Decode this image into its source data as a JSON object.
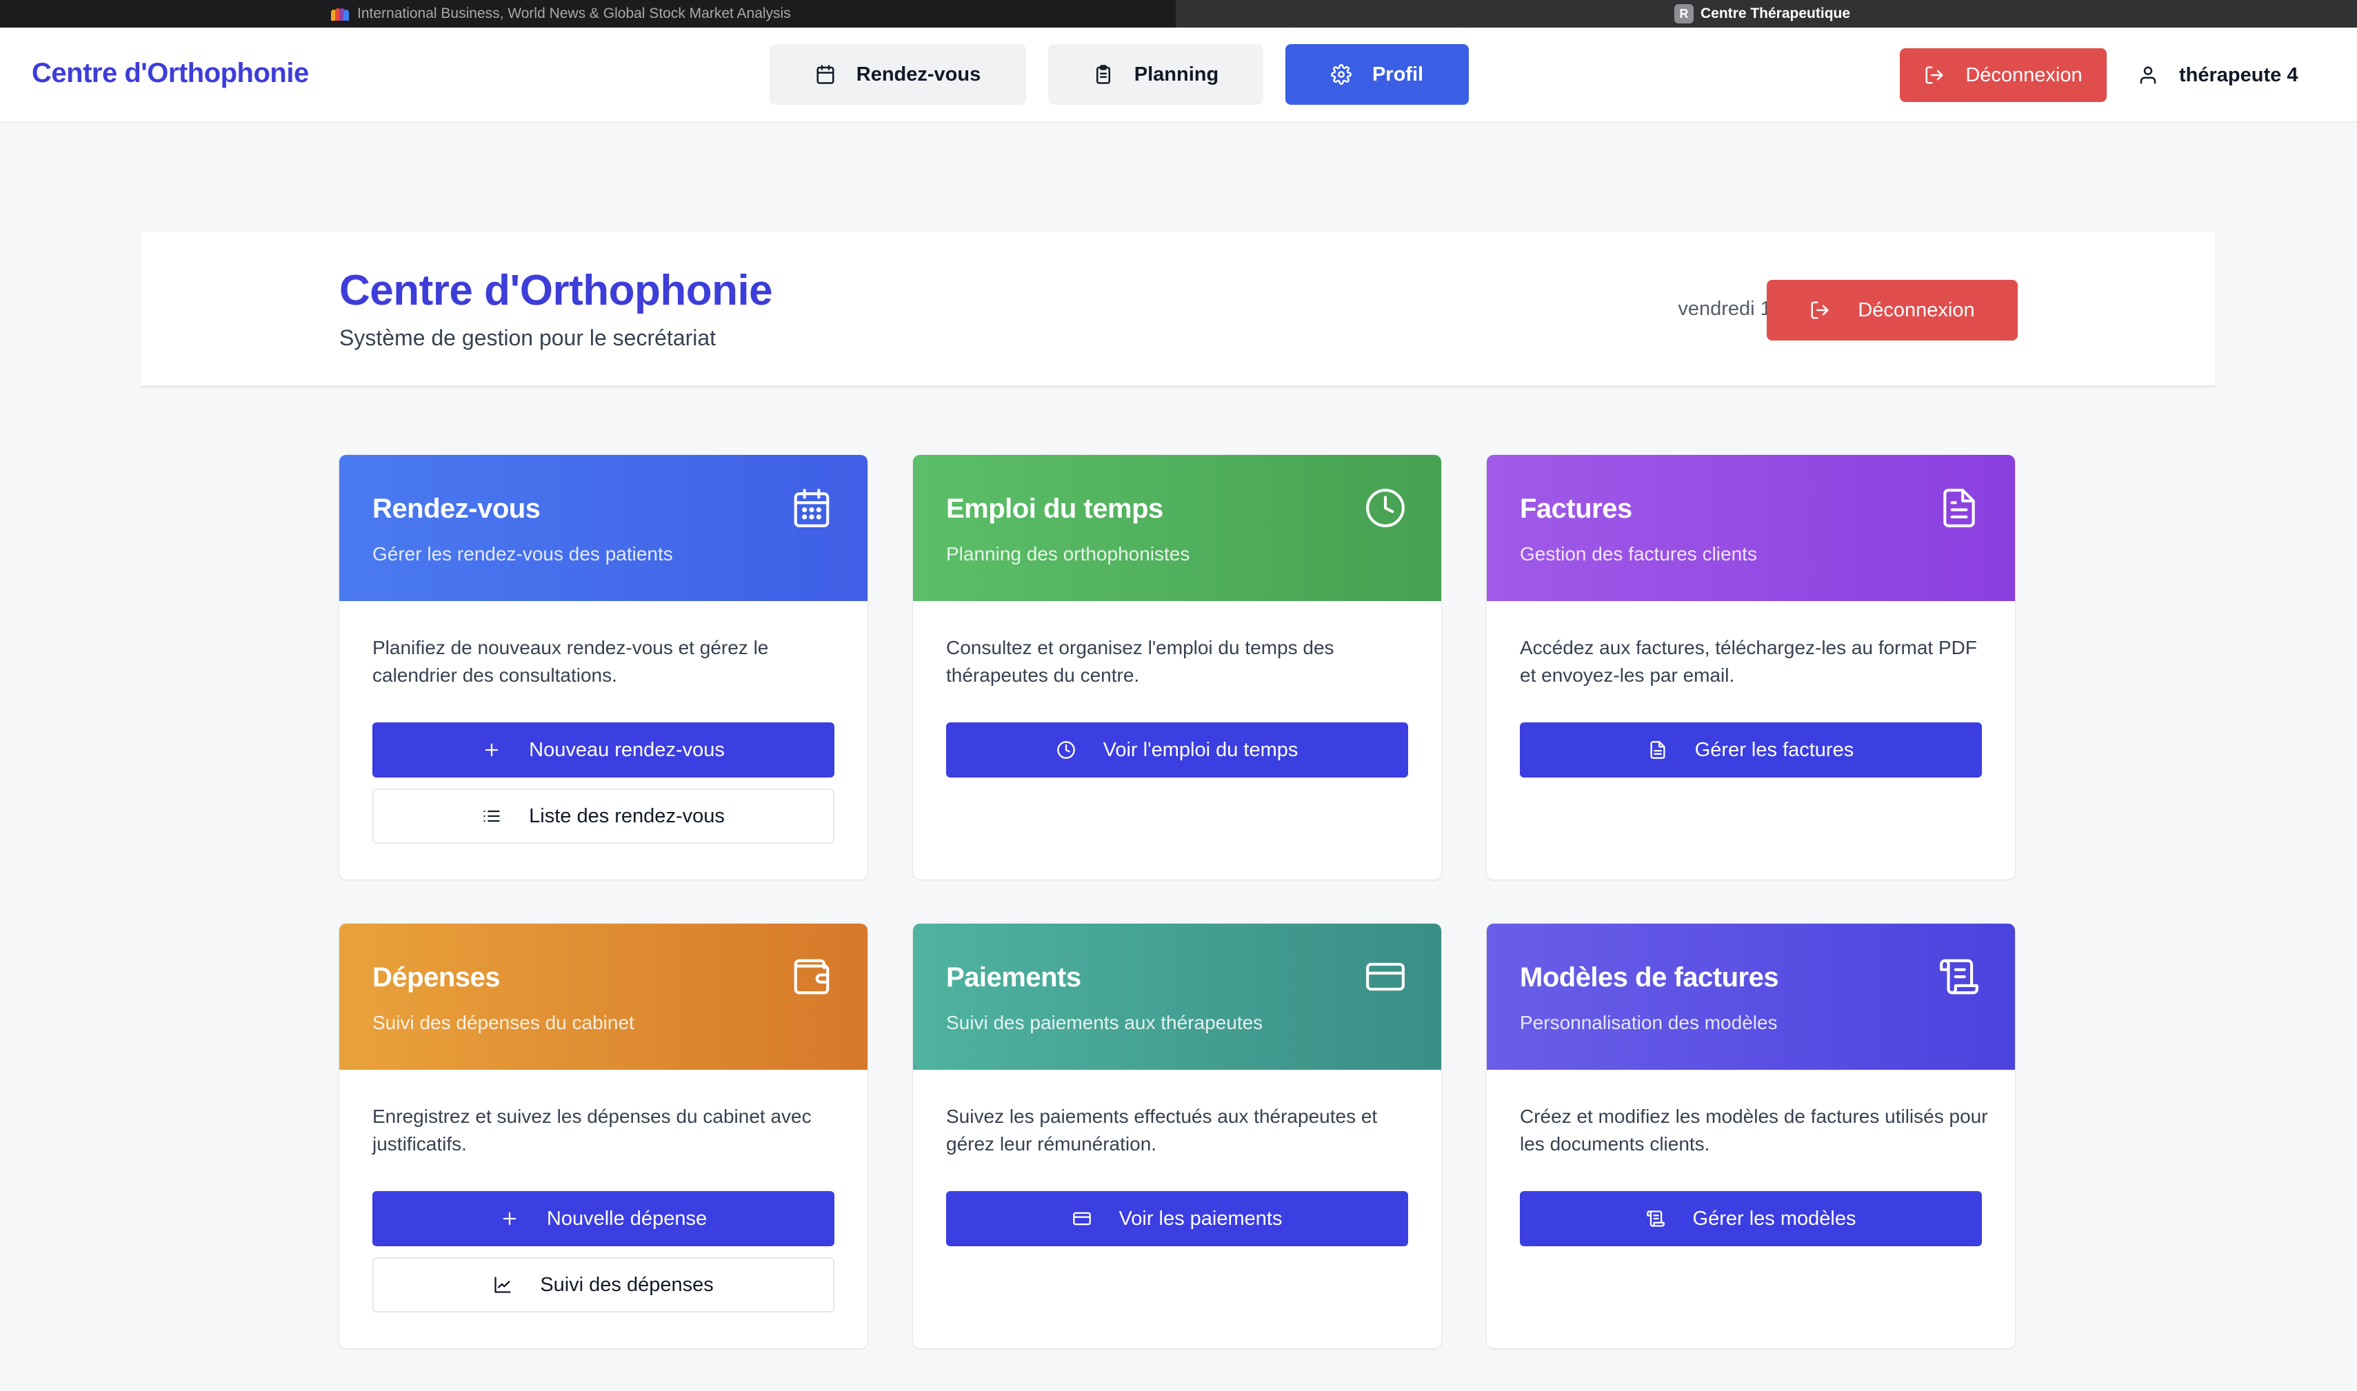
{
  "browser": {
    "tab1_title": "International Business, World News & Global Stock Market Analysis",
    "tab2_title": "Centre Thérapeutique",
    "tab2_favicon_letter": "R"
  },
  "nav": {
    "brand": "Centre d'Orthophonie",
    "items": [
      {
        "label": "Rendez-vous",
        "icon": "calendar-icon"
      },
      {
        "label": "Planning",
        "icon": "clipboard-icon"
      },
      {
        "label": "Profil",
        "icon": "gear-icon"
      }
    ],
    "logout_label": "Déconnexion",
    "user_name": "thérapeute 4"
  },
  "header": {
    "title": "Centre d'Orthophonie",
    "subtitle": "Système de gestion pour le secrétariat",
    "date": "vendredi 14 mars 2025",
    "logout_label": "Déconnexion"
  },
  "cards": [
    {
      "title": "Rendez-vous",
      "subtitle": "Gérer les rendez-vous des patients",
      "description": "Planifiez de nouveaux rendez-vous et gérez le calendrier des consultations.",
      "primary_label": "Nouveau rendez-vous",
      "secondary_label": "Liste des rendez-vous",
      "icon": "calendar-icon",
      "gradient": [
        "#4a7af0",
        "#3f5fe6"
      ]
    },
    {
      "title": "Emploi du temps",
      "subtitle": "Planning des orthophonistes",
      "description": "Consultez et organisez l'emploi du temps des thérapeutes du centre.",
      "primary_label": "Voir l'emploi du temps",
      "icon": "clock-icon",
      "gradient": [
        "#5cbf68",
        "#46a152"
      ]
    },
    {
      "title": "Factures",
      "subtitle": "Gestion des factures clients",
      "description": "Accédez aux factures, téléchargez-les au format PDF et envoyez-les par email.",
      "primary_label": "Gérer les factures",
      "icon": "document-icon",
      "gradient": [
        "#a05ae8",
        "#8a3fdf"
      ]
    },
    {
      "title": "Dépenses",
      "subtitle": "Suivi des dépenses du cabinet",
      "description": "Enregistrez et suivez les dépenses du cabinet avec justificatifs.",
      "primary_label": "Nouvelle dépense",
      "secondary_label": "Suivi des dépenses",
      "icon": "wallet-icon",
      "gradient": [
        "#e9a23b",
        "#d6792a"
      ]
    },
    {
      "title": "Paiements",
      "subtitle": "Suivi des paiements aux thérapeutes",
      "description": "Suivez les paiements effectués aux thérapeutes et gérez leur rémunération.",
      "primary_label": "Voir les paiements",
      "icon": "credit-card-icon",
      "gradient": [
        "#4fb3a0",
        "#3a8e86"
      ]
    },
    {
      "title": "Modèles de factures",
      "subtitle": "Personnalisation des modèles",
      "description": "Créez et modifiez les modèles de factures utilisés pour les documents clients.",
      "primary_label": "Gérer les modèles",
      "icon": "scroll-icon",
      "gradient": [
        "#6a5ee8",
        "#4b43de"
      ]
    }
  ],
  "colors": {
    "brand": "#3d3dd9",
    "primary_button": "#3b3ee0",
    "danger": "#e04d4d",
    "active_nav": "#3b5fe4"
  }
}
